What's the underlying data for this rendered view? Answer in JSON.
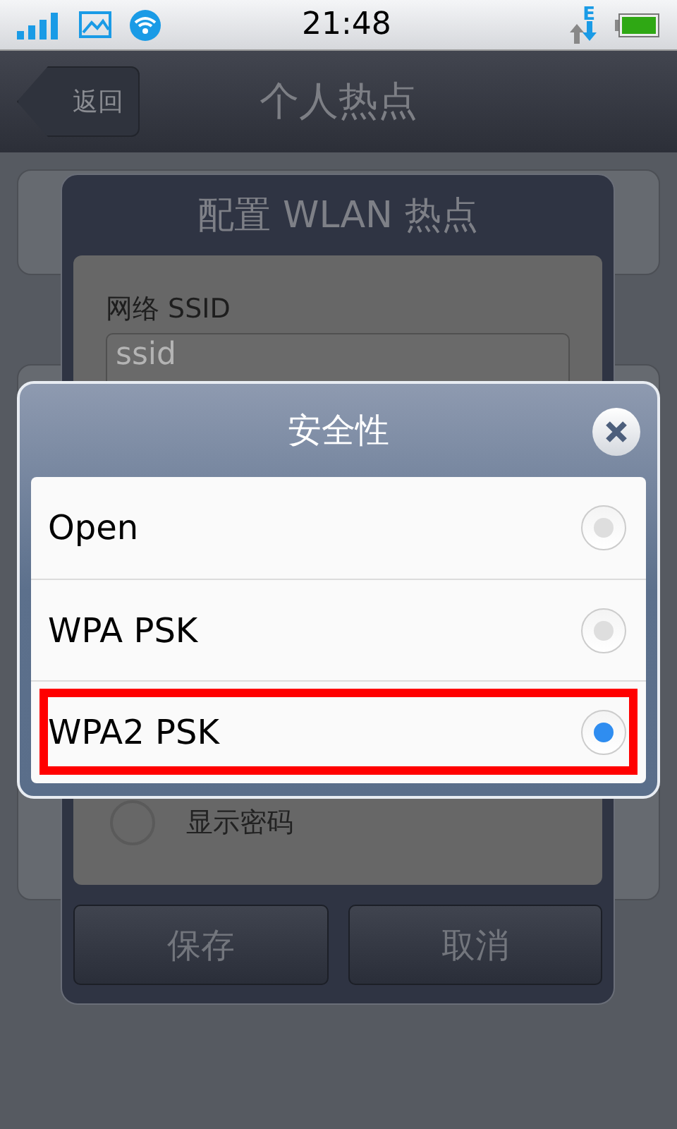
{
  "status_bar": {
    "time": "21:48",
    "network": "E"
  },
  "nav": {
    "back": "返回",
    "title": "个人热点"
  },
  "config_dialog": {
    "title": "配置 WLAN 热点",
    "ssid_label": "网络 SSID",
    "ssid_placeholder": "ssid",
    "show_password": {
      "label": "显示密码",
      "checked": false
    },
    "buttons": [
      "保存",
      "取消"
    ]
  },
  "security_dialog": {
    "title": "安全性",
    "options": [
      {
        "label": "Open",
        "selected": false,
        "highlighted": false
      },
      {
        "label": "WPA PSK",
        "selected": false,
        "highlighted": false
      },
      {
        "label": "WPA2 PSK",
        "selected": true,
        "highlighted": true
      }
    ]
  }
}
